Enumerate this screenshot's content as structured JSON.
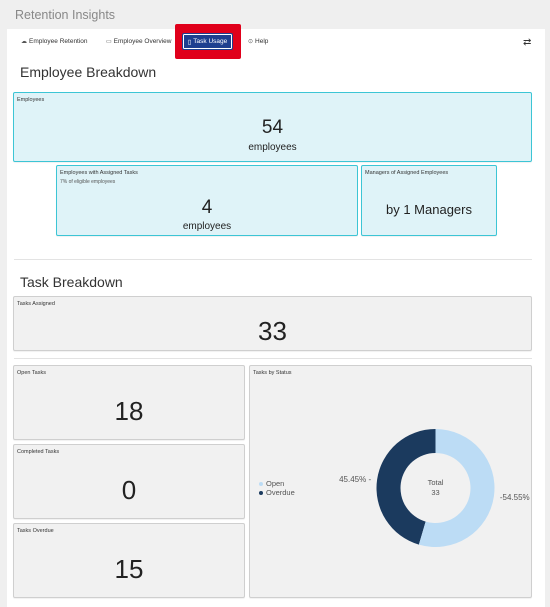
{
  "app": {
    "title": "Retention Insights"
  },
  "tabs": [
    {
      "label": "Employee Retention",
      "icon": "chart-icon"
    },
    {
      "label": "Employee Overview",
      "icon": "grid-icon"
    },
    {
      "label": "Task Usage",
      "icon": "clipboard-icon",
      "active": true
    },
    {
      "label": "Help",
      "icon": "help-icon"
    }
  ],
  "employee_breakdown": {
    "title": "Employee Breakdown",
    "employees": {
      "label": "Employees",
      "value": "54",
      "unit": "employees"
    },
    "assigned": {
      "label": "Employees with Assigned Tasks",
      "sub": "7% of eligible employees",
      "value": "4",
      "unit": "employees"
    },
    "managers": {
      "label": "Managers of Assigned Employees",
      "value": "by 1 Managers"
    }
  },
  "task_breakdown": {
    "title": "Task Breakdown",
    "assigned": {
      "label": "Tasks Assigned",
      "value": "33"
    },
    "open": {
      "label": "Open Tasks",
      "value": "18"
    },
    "completed": {
      "label": "Completed Tasks",
      "value": "0"
    },
    "overdue": {
      "label": "Tasks Overdue",
      "value": "15"
    },
    "status_chart_label": "Tasks by Status"
  },
  "colors": {
    "open": "#bcdcf5",
    "overdue": "#1b3a5e",
    "accent": "#1e3f8f",
    "highlight": "#e0001b",
    "cyan_border": "#3cc5d5"
  },
  "chart_data": {
    "type": "pie",
    "title": "Tasks by Status",
    "center_label": "Total",
    "center_value": "33",
    "slices": [
      {
        "name": "Open",
        "value": 18,
        "label": "54.55%",
        "color": "#bcdcf5"
      },
      {
        "name": "Overdue",
        "value": 15,
        "label": "45.45%",
        "color": "#1b3a5e"
      }
    ],
    "legend_position": "left"
  }
}
